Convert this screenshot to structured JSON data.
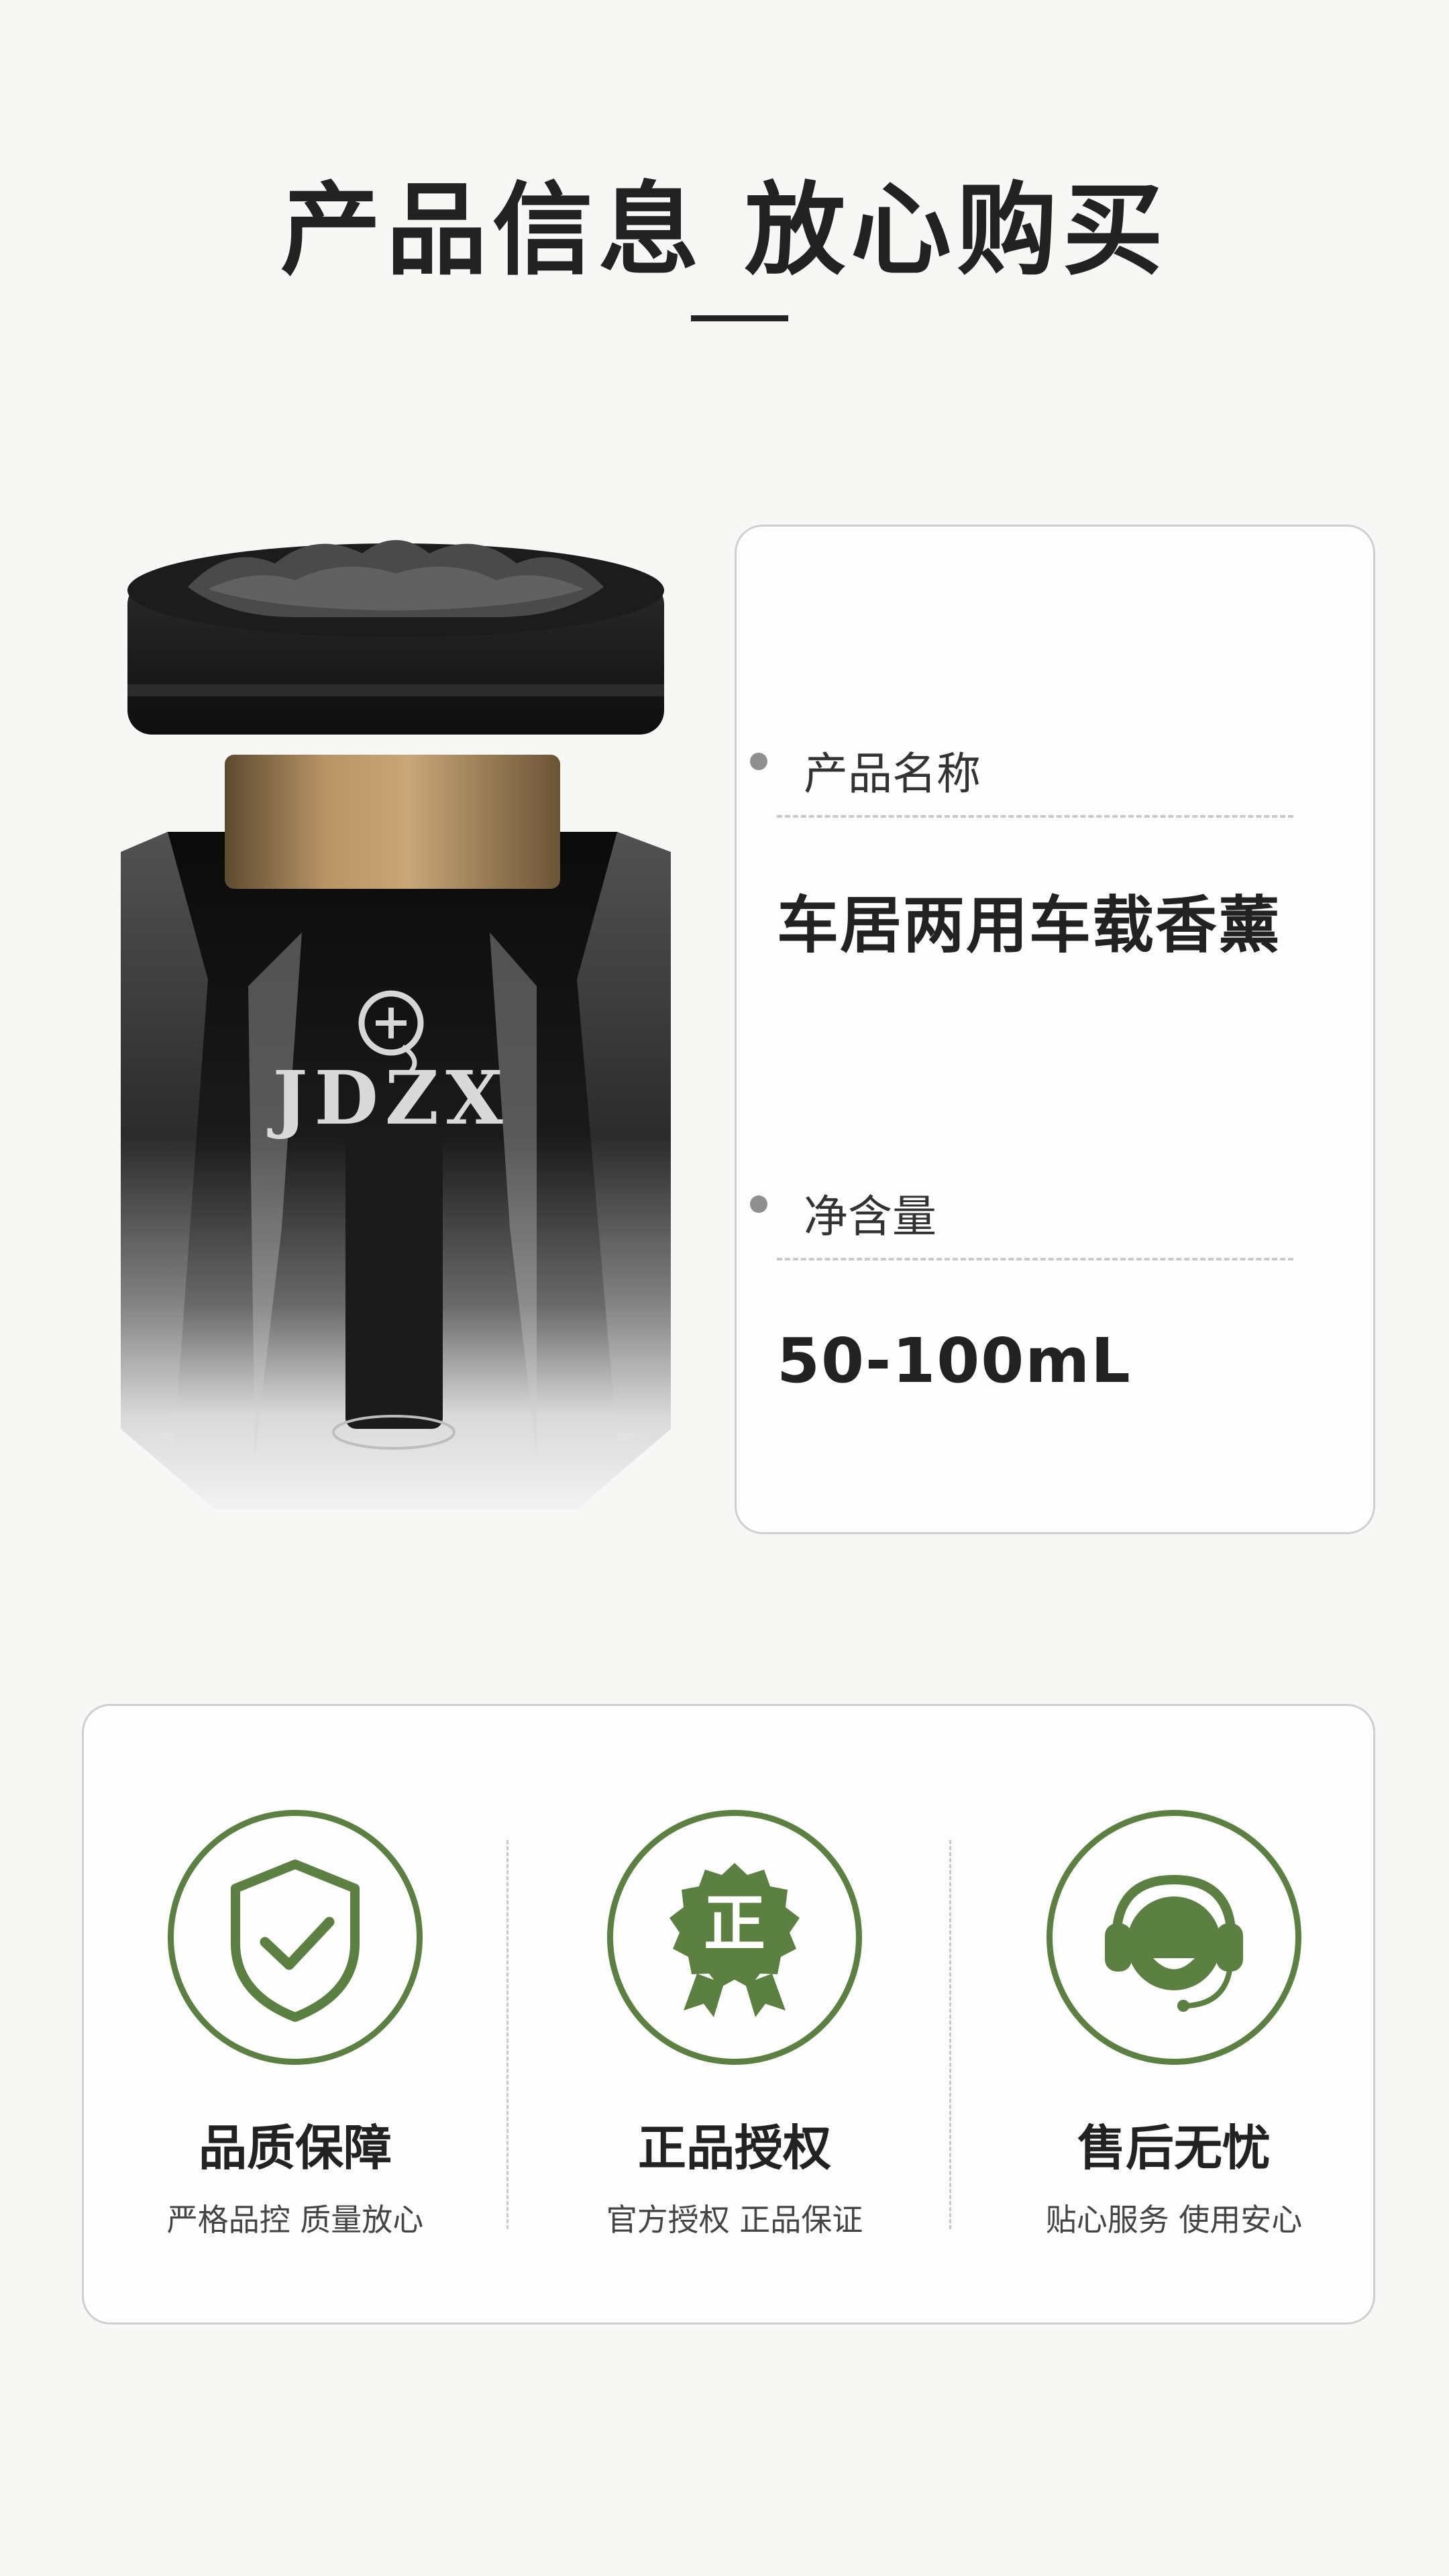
{
  "header": {
    "title": "产品信息 放心购买"
  },
  "product_image": {
    "brand_logo_text": "JDZX"
  },
  "info": {
    "name_label": "产品名称",
    "name_value": "车居两用车载香薰",
    "volume_label": "净含量",
    "volume_value": "50-100mL"
  },
  "features": [
    {
      "icon": "shield-check-icon",
      "title": "品质保障",
      "subtitle": "严格品控 质量放心"
    },
    {
      "icon": "genuine-badge-icon",
      "title": "正品授权",
      "subtitle": "官方授权 正品保证",
      "badge_char": "正"
    },
    {
      "icon": "customer-service-icon",
      "title": "售后无忧",
      "subtitle": "贴心服务 使用安心"
    }
  ],
  "colors": {
    "accent_green": "#5b8042",
    "text_dark": "#222222",
    "background": "#f7f7f6"
  }
}
